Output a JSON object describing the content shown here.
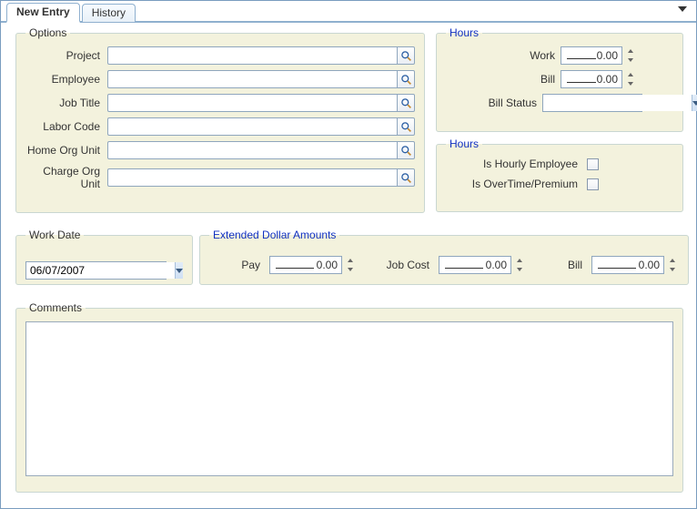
{
  "tabs": {
    "newEntry": "New Entry",
    "history": "History"
  },
  "options": {
    "legend": "Options",
    "labels": {
      "project": "Project",
      "employee": "Employee",
      "jobTitle": "Job Title",
      "laborCode": "Labor Code",
      "homeOrg": "Home Org Unit",
      "chargeOrg": "Charge Org Unit"
    },
    "values": {
      "project": "",
      "employee": "",
      "jobTitle": "",
      "laborCode": "",
      "homeOrg": "",
      "chargeOrg": ""
    }
  },
  "hours": {
    "legend": "Hours",
    "workLabel": "Work",
    "billLabel": "Bill",
    "statusLabel": "Bill Status",
    "workValue": "0.00",
    "billValue": "0.00",
    "statusValue": ""
  },
  "hourFlags": {
    "legend": "Hours",
    "hourlyLabel": "Is Hourly Employee",
    "overtimeLabel": "Is OverTime/Premium"
  },
  "workDate": {
    "legend": "Work Date",
    "value": "06/07/2007"
  },
  "extended": {
    "legend": "Extended Dollar Amounts",
    "payLabel": "Pay",
    "jobCostLabel": "Job Cost",
    "billLabel": "Bill",
    "payValue": "0.00",
    "jobCostValue": "0.00",
    "billValue": "0.00"
  },
  "comments": {
    "legend": "Comments",
    "value": ""
  }
}
